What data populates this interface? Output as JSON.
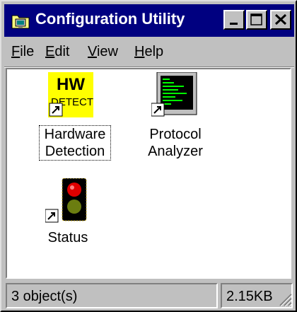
{
  "window": {
    "title": "Configuration Utility"
  },
  "menu": [
    {
      "accel": "F",
      "rest": "ile"
    },
    {
      "accel": "E",
      "rest": "dit"
    },
    {
      "accel": "V",
      "rest": "iew"
    },
    {
      "accel": "H",
      "rest": "elp"
    }
  ],
  "icons": [
    {
      "name": "hardware-detection",
      "line1": "Hardware",
      "line2": "Detection",
      "badge_top": "HW",
      "badge_bottom": "DETECT",
      "focused": true
    },
    {
      "name": "protocol-analyzer",
      "line1": "Protocol",
      "line2": "Analyzer"
    },
    {
      "name": "status",
      "line1": "Status"
    }
  ],
  "statusbar": {
    "objects": "3 object(s)",
    "size": "2.15KB"
  },
  "colors": {
    "title_bg": "#000080",
    "face": "#c0c0c0",
    "hw_badge": "#ffff00",
    "terminal": "#00ff00"
  }
}
